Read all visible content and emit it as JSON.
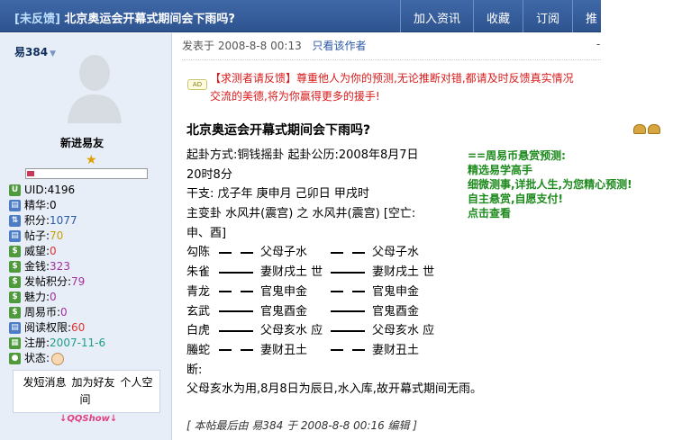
{
  "header": {
    "tag": "[未反馈]",
    "title": "北京奥运会开幕式期间会下雨吗?",
    "nav": [
      "加入资讯",
      "收藏",
      "订阅",
      "推"
    ]
  },
  "user": {
    "name": "易384",
    "rank": "新进易友",
    "stats": [
      {
        "label": "UID: ",
        "value": "4196",
        "icon": "uid-icon"
      },
      {
        "label": "精华: ",
        "value": "0",
        "icon": "digest-icon"
      },
      {
        "label": "积分: ",
        "value": "1077",
        "icon": "points-icon"
      },
      {
        "label": "帖子: ",
        "value": "70",
        "icon": "posts-icon"
      },
      {
        "label": "威望: ",
        "value": "0",
        "icon": "prestige-icon"
      },
      {
        "label": "金钱: ",
        "value": "323",
        "icon": "money-icon"
      },
      {
        "label": "发帖积分: ",
        "value": "79",
        "icon": "post-points-icon"
      },
      {
        "label": "魅力: ",
        "value": "0",
        "icon": "charm-icon"
      },
      {
        "label": "周易币: ",
        "value": "0",
        "icon": "coin-icon"
      },
      {
        "label": "阅读权限: ",
        "value": "60",
        "icon": "read-permission-icon"
      },
      {
        "label": "注册: ",
        "value": "2007-11-6",
        "icon": "register-icon"
      },
      {
        "label": "状态: ",
        "value": "",
        "icon": "status-icon"
      }
    ],
    "links": [
      "发短消息",
      "加为好友",
      "个人空间"
    ],
    "qqshow": "QQShow"
  },
  "post": {
    "posted_label": "发表于",
    "posted_time": "2008-8-8 00:13",
    "only_author": "只看该作者",
    "notice_line1": "【求测者请反馈】尊重他人为你的预测,无论推断对错,都请及时反馈真实情况",
    "notice_line2": "交流的美德,将为你赢得更多的援手!",
    "ad_icon": "AD",
    "title": "北京奥运会开幕式期间会下雨吗?",
    "lines": {
      "l1": "起卦方式:铜钱摇卦   起卦公历:2008年8月7日",
      "l2": "20时8分",
      "l3": "干支:   戊子年  庚申月  己卯日  甲戌时",
      "l4": "主变卦    水风井(震宫)  之  水风井(震宫)  [空亡:",
      "l5": "申、酉]"
    },
    "yao": [
      {
        "god": "勾陈",
        "line1": "broken",
        "text1": "父母子水",
        "line2": "broken",
        "text2": "父母子水"
      },
      {
        "god": "朱雀",
        "line1": "solid",
        "text1": "妻财戌土  世",
        "line2": "solid",
        "text2": "妻财戌土  世"
      },
      {
        "god": "青龙",
        "line1": "broken",
        "text1": "官鬼申金",
        "line2": "broken",
        "text2": "官鬼申金"
      },
      {
        "god": "玄武",
        "line1": "solid",
        "text1": "官鬼酉金",
        "line2": "solid",
        "text2": "官鬼酉金"
      },
      {
        "god": "白虎",
        "line1": "solid",
        "text1": "父母亥水  应",
        "line2": "solid",
        "text2": "父母亥水  应"
      },
      {
        "god": "螣蛇",
        "line1": "broken",
        "text1": "妻财丑土",
        "line2": "broken",
        "text2": "妻财丑土"
      }
    ],
    "duan": "断:",
    "conclusion": "父母亥水为用,8月8日为辰日,水入库,故开幕式期间无雨。",
    "edit_note": "[ 本帖最后由  易384  于  2008-8-8 00:16  编辑 ]"
  },
  "promo": [
    "==周易币悬赏预测:",
    "精选易学高手",
    "细微测事,详批人生,为您精心预测!",
    "自主悬赏,自愿支付!",
    "点击查看"
  ]
}
